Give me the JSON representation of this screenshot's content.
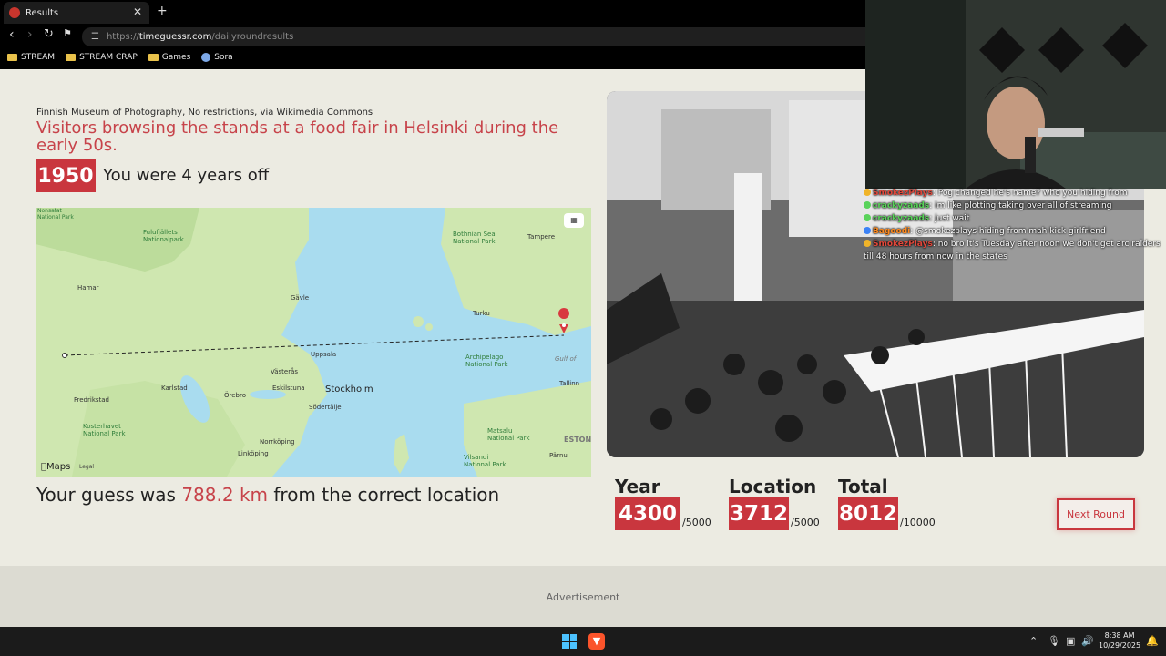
{
  "browser": {
    "tab_title": "Results",
    "new_tab": "+",
    "close": "✕",
    "url_prefix": "https://",
    "url_host": "timeguessr.com",
    "url_path": "/dailyroundresults",
    "bookmarks": [
      "STREAM",
      "STREAM CRAP",
      "Games",
      "Sora"
    ]
  },
  "result": {
    "credit": "Finnish Museum of Photography, No restrictions, via Wikimedia Commons",
    "title": "Visitors browsing the stands at a food fair in Helsinki during the early 50s.",
    "year": "1950",
    "years_off": "You were 4 years off",
    "guess_prefix": "Your guess was ",
    "distance": "788.2 km",
    "guess_suffix": " from the correct location"
  },
  "map": {
    "labels": {
      "national_park_tl": "Nonsafat\nNational Park",
      "fulufjallets": "Fulufjällets\nNationalpark",
      "bothnian_sea": "Bothnian Sea\nNational Park",
      "tampere": "Tampere",
      "hamar": "Hamar",
      "gavle": "Gävle",
      "turku": "Turku",
      "uppsala": "Uppsala",
      "vasteras": "Västerås",
      "archipelago": "Archipelago\nNational Park",
      "karlstad": "Karlstad",
      "orebro": "Örebro",
      "eskilstuna": "Eskilstuna",
      "stockholm": "Stockholm",
      "tallinn": "Tallinn",
      "fredrikstad": "Fredrikstad",
      "sodertalje": "Södertälje",
      "kosterhavet": "Kosterhavet\nNational Park",
      "norrkoping": "Norrköping",
      "matsalu": "Matsalu\nNational Park",
      "estonia": "ESTONI",
      "linkoping": "Linköping",
      "vilsandi": "Vilsandi\nNational Park",
      "parnu": "Pärnu",
      "gulf": "Gulf of"
    },
    "logo": "Maps",
    "legal": "Legal"
  },
  "scores": {
    "year_label": "Year",
    "year_score": "4300",
    "year_max": "/5000",
    "location_label": "Location",
    "location_score": "3712",
    "location_max": "/5000",
    "total_label": "Total",
    "total_score": "8012",
    "total_max": "/10000"
  },
  "next_round": "Next Round",
  "advertisement": "Advertisement",
  "chat": [
    {
      "user": "SmokezPlays",
      "color": "red",
      "text": ": Pog changed he's name? who you hiding from"
    },
    {
      "user": "crackyzaads",
      "color": "green",
      "text": ": im like plotting taking over all of streaming"
    },
    {
      "user": "crackyzaads",
      "color": "green",
      "text": ": just wait"
    },
    {
      "user": "Bagoodi",
      "color": "orange",
      "text": ": @smokezplays hiding from mah kick girlfriend"
    },
    {
      "user": "SmokezPlays",
      "color": "red",
      "text": ": no bro it's Tuesday after noon we don't get arc raiders till 48 hours from now in the states"
    }
  ],
  "taskbar": {
    "time": "8:38 AM",
    "date": "10/29/2025"
  },
  "colors": {
    "accent": "#c9363e",
    "page_bg": "#ecebe2",
    "water": "#a9dcef",
    "land": "#cfe7b0"
  }
}
